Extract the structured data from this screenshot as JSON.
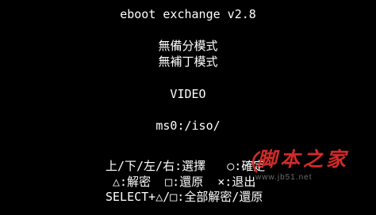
{
  "screen": {
    "title": "eboot exchange v2.8",
    "menu": [
      {
        "label": "無備分模式"
      },
      {
        "label": "無補丁模式"
      },
      {
        "label": "VIDEO"
      },
      {
        "label": "ms0:/iso/"
      }
    ],
    "help": [
      "上/下/左/右:選擇   ○:確定",
      " △:解密  □:還原  ×:退出",
      "SELECT+△/□:全部解密/還原"
    ]
  },
  "watermark": {
    "brand": "脚本之家",
    "url": "www.jb51.net"
  },
  "colors": {
    "background": "#000000",
    "text": "#ffffff",
    "watermark": "#d42a2a"
  }
}
